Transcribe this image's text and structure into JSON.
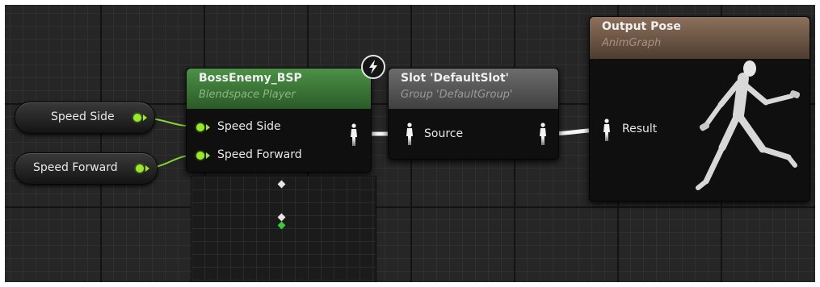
{
  "variables": {
    "speed_side": {
      "label": "Speed Side"
    },
    "speed_forward": {
      "label": "Speed Forward"
    }
  },
  "blendspace_node": {
    "title": "BossEnemy_BSP",
    "subtitle": "Blendspace Player",
    "inputs": [
      "Speed Side",
      "Speed Forward"
    ],
    "header_color": "#3e7a3a"
  },
  "slot_node": {
    "title": "Slot 'DefaultSlot'",
    "subtitle": "Group 'DefaultGroup'",
    "input": "Source",
    "header_color": "#5a5a5a"
  },
  "output_node": {
    "title": "Output Pose",
    "subtitle": "AnimGraph",
    "input": "Result",
    "header_color": "#6b5544"
  },
  "colors": {
    "float_pin": "#9ae82b",
    "pose_wire": "#ffffff",
    "graph_bg": "#262626"
  },
  "icons": {
    "fast_path": "lightning-bolt-icon",
    "pose_pin": "mannequin-pose-icon",
    "preview_character": "running-mannequin"
  }
}
